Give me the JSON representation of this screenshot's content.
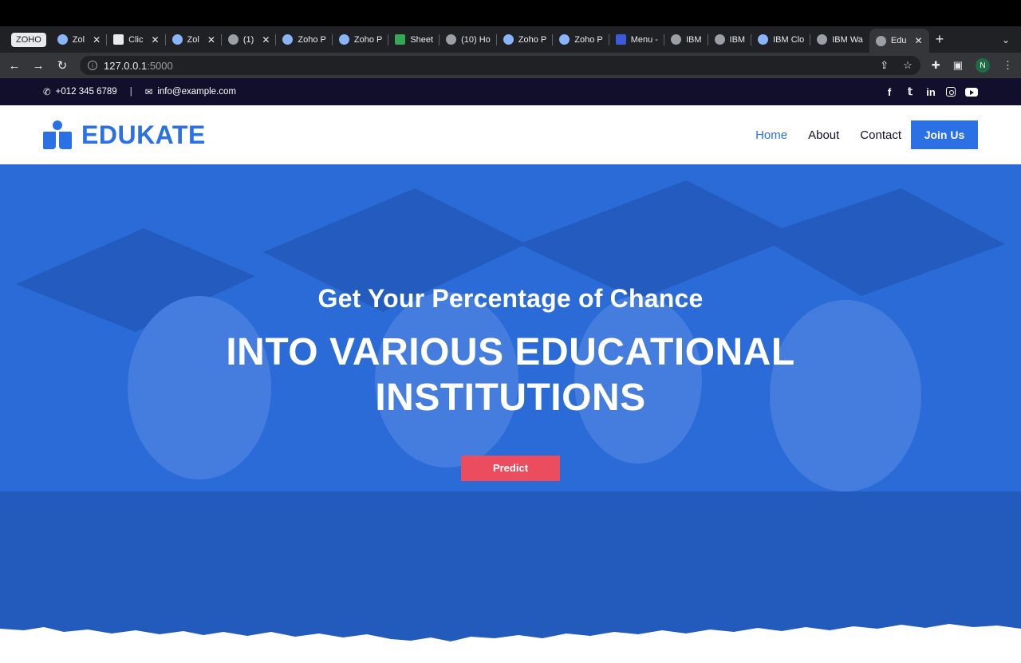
{
  "browser": {
    "tabs": [
      {
        "label": "ZOHO",
        "icon": "zoho-badge"
      },
      {
        "label": "Zol",
        "icon": "zoho-people-icon",
        "closable": true
      },
      {
        "label": "Clic",
        "icon": "chat-icon",
        "closable": true
      },
      {
        "label": "Zol",
        "icon": "zoho-people-icon",
        "closable": true
      },
      {
        "label": "(1)",
        "icon": "mail-icon",
        "closable": true
      },
      {
        "label": "Zoho P",
        "icon": "zoho-people-icon"
      },
      {
        "label": "Zoho P",
        "icon": "zoho-people-icon"
      },
      {
        "label": "Sheet",
        "icon": "sheet-icon"
      },
      {
        "label": "(10) Ho",
        "icon": "mail-icon"
      },
      {
        "label": "Zoho P",
        "icon": "zoho-people-icon"
      },
      {
        "label": "Zoho P",
        "icon": "zoho-people-icon"
      },
      {
        "label": "Menu -",
        "icon": "zc-icon"
      },
      {
        "label": "IBM",
        "icon": "globe-icon"
      },
      {
        "label": "IBM",
        "icon": "globe-icon"
      },
      {
        "label": "IBM Clo",
        "icon": "ibm-cloud-icon"
      },
      {
        "label": "IBM Wa",
        "icon": "github-icon"
      },
      {
        "label": "Edu",
        "icon": "globe-icon",
        "active": true,
        "closable": true
      }
    ],
    "url_host": "127.0.0.1",
    "url_port": ":5000",
    "profile_initial": "N"
  },
  "topbar": {
    "phone": "+012 345 6789",
    "email": "info@example.com",
    "separator": "|",
    "socials": [
      "facebook-icon",
      "twitter-icon",
      "linkedin-icon",
      "instagram-icon",
      "youtube-icon"
    ]
  },
  "nav": {
    "brand": "EDUKATE",
    "links": [
      {
        "label": "Home",
        "active": true
      },
      {
        "label": "About",
        "active": false
      },
      {
        "label": "Contact",
        "active": false
      }
    ],
    "cta": "Join Us"
  },
  "hero": {
    "subtitle": "Get Your Percentage of Chance",
    "title_line1": "INTO VARIOUS EDUCATIONAL",
    "title_line2": "INSTITUTIONS",
    "button": "Predict"
  },
  "colors": {
    "primary": "#2b70e4",
    "dark": "#120f2d",
    "accent": "#ec4d5e"
  }
}
